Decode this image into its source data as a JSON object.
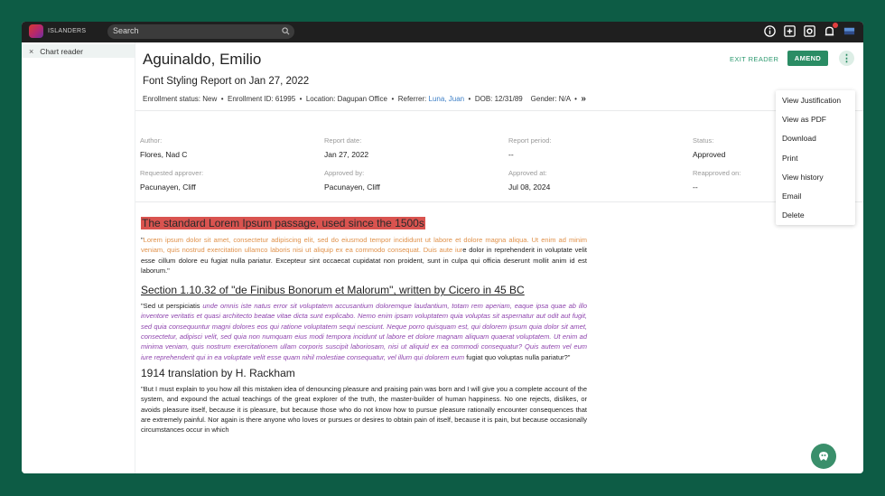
{
  "app": {
    "brand": "ISLANDERS"
  },
  "search": {
    "placeholder": "Search"
  },
  "sidebar": {
    "tab_close": "×",
    "tab_label": "Chart reader"
  },
  "report": {
    "patient_name": "Aguinaldo, Emilio",
    "title": "Font Styling Report on Jan 27, 2022",
    "meta": {
      "enrollment_status_label": "Enrollment status:",
      "enrollment_status": "New",
      "enrollment_id_label": "Enrollment ID:",
      "enrollment_id": "61995",
      "location_label": "Location:",
      "location": "Dagupan Office",
      "referrer_label": "Referrer:",
      "referrer": "Luna, Juan",
      "dob_label": "DOB:",
      "dob": "12/31/89",
      "gender_label": "Gender:",
      "gender": "N/A",
      "more": "»"
    },
    "fields": [
      {
        "label": "Author:",
        "value": "Flores, Nad C"
      },
      {
        "label": "Report date:",
        "value": "Jan 27, 2022"
      },
      {
        "label": "Report period:",
        "value": "--"
      },
      {
        "label": "Status:",
        "value": "Approved"
      },
      {
        "label": "Requested approver:",
        "value": "Pacunayen, Cliff"
      },
      {
        "label": "Approved by:",
        "value": "Pacunayen, Cliff"
      },
      {
        "label": "Approved at:",
        "value": "Jul 08, 2024"
      },
      {
        "label": "Reapproved on:",
        "value": "--"
      }
    ]
  },
  "actions": {
    "exit_reader": "EXIT READER",
    "amend": "AMEND",
    "more": "⋮"
  },
  "menu": {
    "items": [
      "View Justification",
      "View as PDF",
      "Download",
      "Print",
      "View history",
      "Email",
      "Delete"
    ]
  },
  "document": {
    "heading1": "The standard Lorem Ipsum passage, used since the 1500s",
    "p1_open": "\"",
    "p1_orange": "Lorem ipsum dolor sit amet, consectetur adipiscing elit, sed do eiusmod tempor incididunt ut labore et dolore magna aliqua. Ut enim ad minim veniam, quis nostrud exercitation ullamco laboris nisi ut aliquip ex ea commodo consequat. Duis aute iur",
    "p1_rest": "e dolor in reprehenderit in voluptate velit esse cillum dolore eu fugiat nulla pariatur. Excepteur sint occaecat cupidatat non proident, sunt in culpa qui officia deserunt mollit anim id est laborum.\"",
    "heading2": "Section 1.10.32 of \"de Finibus Bonorum et Malorum\", written by Cicero in 45 BC",
    "p2_start": "\"Sed ut perspiciatis ",
    "p2_purple": "unde omnis iste natus error sit voluptatem accusantium doloremque laudantium, totam rem aperiam, eaque ipsa quae ab illo inventore veritatis et quasi architecto beatae vitae dicta sunt explicabo. Nemo enim ipsam voluptatem quia voluptas sit aspernatur aut odit aut fugit, sed quia consequuntur magni dolores eos qui ratione voluptatem sequi nesciunt. Neque porro quisquam est, qui dolorem ipsum quia dolor sit amet, consectetur, adipisci velit, sed quia non numquam eius modi tempora incidunt ut labore et dolore magnam aliquam quaerat voluptatem. Ut enim ad minima veniam, quis nostrum exercitationem ullam corporis suscipit laboriosam, nisi ut aliquid ex ea commodi consequatur? Quis autem vel eum iure reprehenderit qui in ea voluptate velit esse quam nihil molestiae consequatur, vel illum qui dolorem eum",
    "p2_end": " fugiat quo voluptas nulla pariatur?\"",
    "heading3": "1914 translation by H. Rackham",
    "p3": "\"But I must explain to you how all this mistaken idea of denouncing pleasure and praising pain was born and I will give you a complete account of the system, and expound the actual teachings of the great explorer of the truth, the master-builder of human happiness. No one rejects, dislikes, or avoids pleasure itself, because it is pleasure, but because those who do not know how to pursue pleasure rationally encounter consequences that are extremely painful. Nor again is there anyone who loves or pursues or desires to obtain pain of itself, because it is pain, but because occasionally circumstances occur in which"
  },
  "colors": {
    "page_bg": "#0d5c45",
    "topbar": "#1f1f1f",
    "accent": "#2a8c64",
    "heading_highlight": "#d9534f",
    "orange_text": "#e0914a",
    "purple_text": "#8e44ad",
    "link": "#3d7fc6"
  },
  "icons": [
    "search-icon",
    "info-icon",
    "plus-square-icon",
    "settings-icon",
    "notification-icon",
    "flag-icon",
    "help-bot-icon"
  ]
}
